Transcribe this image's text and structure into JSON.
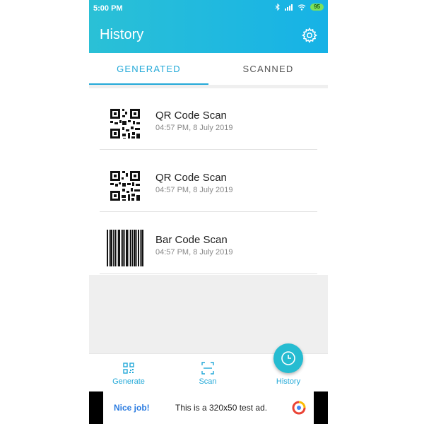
{
  "status_bar": {
    "time": "5:00 PM",
    "battery": "95"
  },
  "app_bar": {
    "title": "History"
  },
  "tabs": [
    {
      "label": "GENERATED",
      "active": true
    },
    {
      "label": "SCANNED",
      "active": false
    }
  ],
  "history": [
    {
      "title": "QR Code Scan",
      "time": "04:57 PM, 8 July 2019",
      "icon": "qr-code-icon"
    },
    {
      "title": "QR Code Scan",
      "time": "04:57 PM, 8 July 2019",
      "icon": "qr-code-icon"
    },
    {
      "title": "Bar Code Scan",
      "time": "04:57 PM, 8 July 2019",
      "icon": "barcode-icon"
    }
  ],
  "bottom_nav": [
    {
      "label": "Generate",
      "icon": "qr-frame-icon"
    },
    {
      "label": "Scan",
      "icon": "scan-frame-icon"
    },
    {
      "label": "History",
      "icon": "clock-icon",
      "active": true
    }
  ],
  "ad": {
    "headline": "Nice job!",
    "text": "This is a 320x50 test ad."
  },
  "colors": {
    "accent": "#23a9d8",
    "header_start": "#2ac0d6",
    "header_end": "#16b2e6"
  }
}
